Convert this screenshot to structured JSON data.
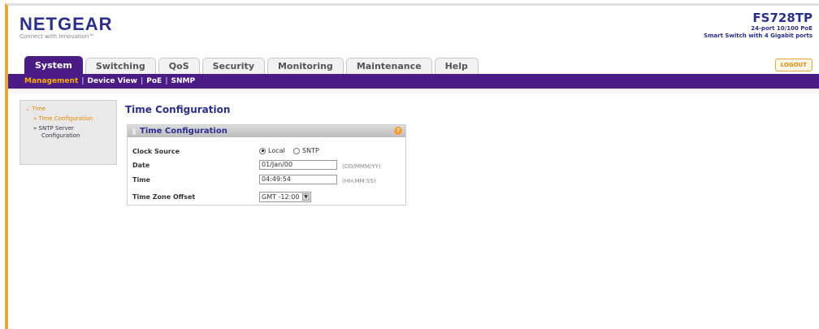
{
  "brand": {
    "name": "NETGEAR",
    "tagline": "Connect with Innovation™"
  },
  "product": {
    "model": "FS728TP",
    "desc_line1": "24-port 10/100 PoE",
    "desc_line2": "Smart Switch with 4 Gigabit ports"
  },
  "tabs": [
    "System",
    "Switching",
    "QoS",
    "Security",
    "Monitoring",
    "Maintenance",
    "Help"
  ],
  "active_tab": "System",
  "logout": "LOGOUT",
  "subnav": [
    "Management",
    "Device View",
    "PoE",
    "SNMP"
  ],
  "sidebar": {
    "group": "Time",
    "items": [
      "Time Configuration",
      "SNTP Server",
      "Configuration"
    ]
  },
  "page_title": "Time Configuration",
  "panel": {
    "title": "Time Configuration",
    "help_glyph": "?",
    "fields": {
      "clock_source_label": "Clock Source",
      "clock_source_options": [
        "Local",
        "SNTP"
      ],
      "clock_source_selected": "Local",
      "date_label": "Date",
      "date_value": "01/Jan/00",
      "date_hint": "(DD/MMM/YY)",
      "time_label": "Time",
      "time_value": "04:49:54",
      "time_hint": "(HH:MM:SS)",
      "tz_label": "Time Zone Offset",
      "tz_value": "GMT -12:00"
    }
  },
  "colors": {
    "accent": "#4b1b86",
    "brand_blue": "#2a2f8f",
    "orange": "#e08b00"
  }
}
